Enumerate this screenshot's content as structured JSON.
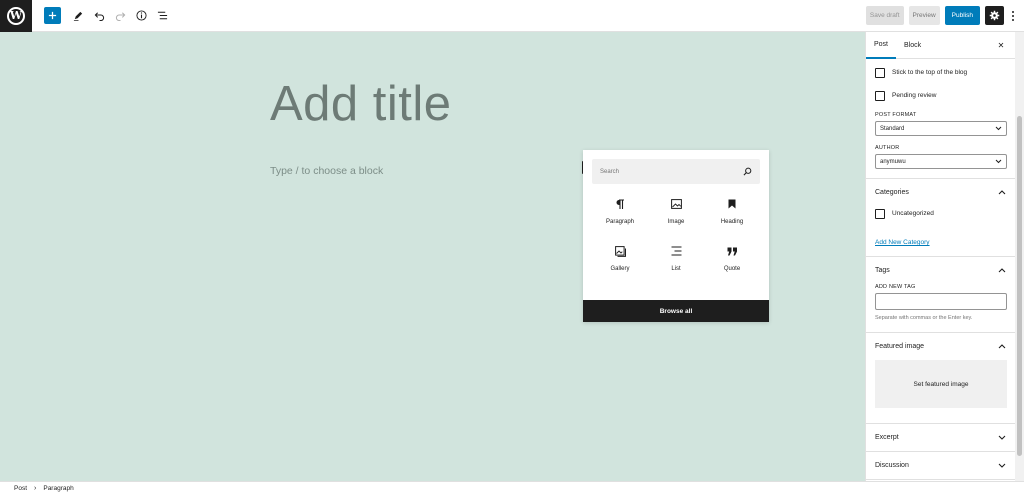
{
  "toolbar": {
    "logo_letter": "W",
    "save_draft_label": "Save draft",
    "preview_label": "Preview",
    "publish_label": "Publish",
    "accent_color": "#007cba"
  },
  "editor": {
    "title_placeholder": "Add title",
    "block_placeholder": "Type / to choose a block",
    "background_color": "#d1e4dd"
  },
  "inserter": {
    "search_placeholder": "Search",
    "blocks": [
      {
        "label": "Paragraph",
        "icon": "paragraph-icon"
      },
      {
        "label": "Image",
        "icon": "image-icon"
      },
      {
        "label": "Heading",
        "icon": "heading-bookmark-icon"
      },
      {
        "label": "Gallery",
        "icon": "gallery-icon"
      },
      {
        "label": "List",
        "icon": "list-icon"
      },
      {
        "label": "Quote",
        "icon": "quote-icon"
      }
    ],
    "browse_all_label": "Browse all"
  },
  "sidebar": {
    "tabs": [
      {
        "label": "Post"
      },
      {
        "label": "Block"
      }
    ],
    "close_symbol": "✕",
    "status": {
      "sticky_label": "Stick to the top of the blog",
      "pending_label": "Pending review",
      "format_label": "POST FORMAT",
      "format_value": "Standard",
      "author_label": "AUTHOR",
      "author_value": "anymuwu"
    },
    "categories": {
      "title": "Categories",
      "items": [
        {
          "label": "Uncategorized"
        }
      ],
      "add_link": "Add New Category"
    },
    "tags": {
      "title": "Tags",
      "field_label": "ADD NEW TAG",
      "help": "Separate with commas or the Enter key."
    },
    "featured_image": {
      "title": "Featured image",
      "button_label": "Set featured image"
    },
    "excerpt": {
      "title": "Excerpt"
    },
    "discussion": {
      "title": "Discussion"
    }
  },
  "footer": {
    "breadcrumbs": [
      "Post",
      "Paragraph"
    ],
    "separator": "›"
  }
}
